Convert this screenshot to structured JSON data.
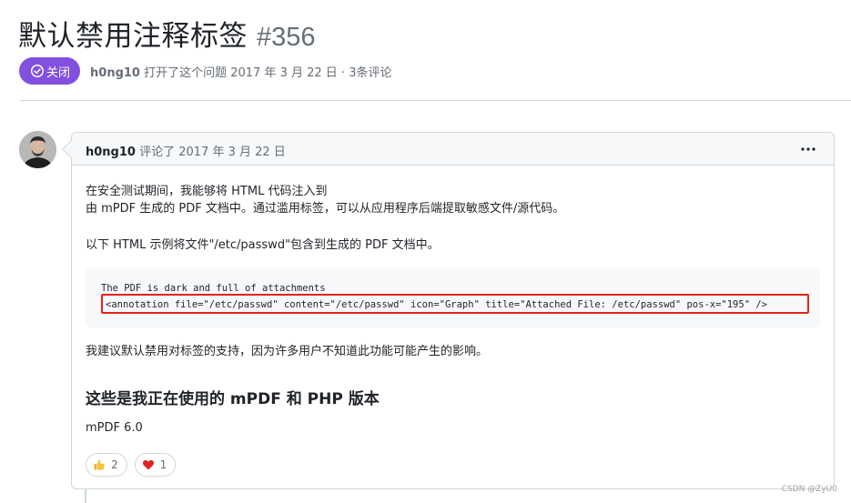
{
  "issue": {
    "title": "默认禁用注释标签",
    "number": "#356",
    "state_label": "关闭",
    "author": "h0ng10",
    "meta_text": "打开了这个问题 2017 年 3 月 22 日 · 3条评论"
  },
  "comment": {
    "author": "h0ng10",
    "action_text": "评论了 2017 年 3 月 22 日",
    "paragraph1_line1": "在安全测试期间，我能够将 HTML 代码注入到",
    "paragraph1_line2": "由 mPDF 生成的 PDF 文档中。通过滥用标签，可以从应用程序后端提取敏感文件/源代码。",
    "paragraph2": "以下 HTML 示例将文件\"/etc/passwd\"包含到生成的 PDF 文档中。",
    "code_line1": "The PDF is dark and full of attachments",
    "code_line2": "<annotation file=\"/etc/passwd\" content=\"/etc/passwd\"  icon=\"Graph\" title=\"Attached File: /etc/passwd\" pos-x=\"195\" />",
    "paragraph3": "我建议默认禁用对标签的支持，因为许多用户不知道此功能可能产生的影响。",
    "heading": "这些是我正在使用的 mPDF 和 PHP 版本",
    "paragraph4": "mPDF 6.0",
    "reactions": [
      {
        "emoji": "thumbs-up",
        "count": "2"
      },
      {
        "emoji": "heart",
        "count": "1"
      }
    ]
  },
  "watermark": "CSDN @ZyU0",
  "colors": {
    "closed_badge": "#8250df",
    "highlight_border": "#e0241c",
    "border": "#d0d7de",
    "muted_text": "#656d76"
  }
}
